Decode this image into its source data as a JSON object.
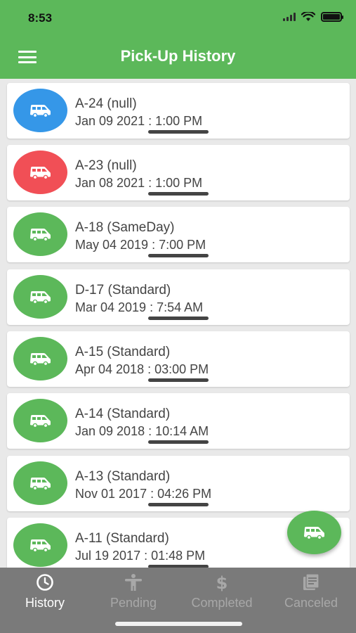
{
  "status_bar": {
    "time": "8:53"
  },
  "header": {
    "title": "Pick-Up History"
  },
  "colors": {
    "green": "#5cb85a",
    "blue": "#3597e8",
    "red": "#f14f56"
  },
  "pickups": [
    {
      "name": "A-24 (null)",
      "date": "Jan 09 2021 : 1:00 PM",
      "status_color": "blue",
      "icon": "van-icon"
    },
    {
      "name": "A-23 (null)",
      "date": "Jan 08 2021 : 1:00 PM",
      "status_color": "red",
      "icon": "van-icon"
    },
    {
      "name": "A-18 (SameDay)",
      "date": "May 04 2019 : 7:00 PM",
      "status_color": "green",
      "icon": "van-icon"
    },
    {
      "name": "D-17 (Standard)",
      "date": "Mar 04 2019 : 7:54 AM",
      "status_color": "green",
      "icon": "van-icon"
    },
    {
      "name": "A-15 (Standard)",
      "date": "Apr 04 2018 : 03:00 PM",
      "status_color": "green",
      "icon": "van-icon"
    },
    {
      "name": "A-14 (Standard)",
      "date": "Jan 09 2018 : 10:14 AM",
      "status_color": "green",
      "icon": "van-icon"
    },
    {
      "name": "A-13 (Standard)",
      "date": "Nov 01 2017 : 04:26 PM",
      "status_color": "green",
      "icon": "van-icon"
    },
    {
      "name": "A-11 (Standard)",
      "date": "Jul 19 2017 : 01:48 PM",
      "status_color": "green",
      "icon": "van-icon"
    }
  ],
  "tabs": [
    {
      "label": "History",
      "icon": "clock-icon",
      "active": true
    },
    {
      "label": "Pending",
      "icon": "person-icon",
      "active": false
    },
    {
      "label": "Completed",
      "icon": "dollar-icon",
      "active": false
    },
    {
      "label": "Canceled",
      "icon": "document-icon",
      "active": false
    }
  ]
}
